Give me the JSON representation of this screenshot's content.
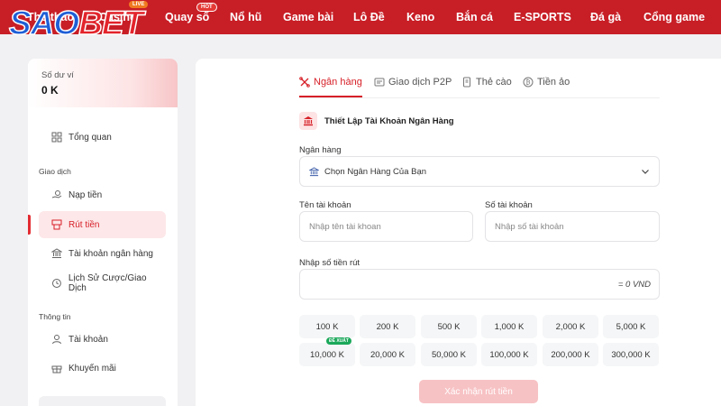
{
  "brand": {
    "logo_part1": "SAO",
    "logo_part2": "BET"
  },
  "nav": {
    "items": [
      "Thể thao",
      "Casino",
      "Quay số",
      "Nổ hũ",
      "Game bài",
      "Lô Đề",
      "Keno",
      "Bắn cá",
      "E-SPORTS",
      "Đá gà",
      "Cổng game"
    ],
    "badge_live": "LIVE",
    "badge_hot": "HOT"
  },
  "sidebar": {
    "wallet_label": "Số dư ví",
    "wallet_value": "0 K",
    "overview": "Tổng quan",
    "section_transactions": "Giao dịch",
    "deposit": "Nạp tiền",
    "withdraw": "Rút tiền",
    "bank_accounts": "Tài khoản ngân hàng",
    "history": "Lịch Sử Cược/Giao Dịch",
    "section_info": "Thông tin",
    "account": "Tài khoản",
    "promotions": "Khuyến mãi"
  },
  "tabs": [
    "Ngân hàng",
    "Giao dịch P2P",
    "Thẻ cào",
    "Tiền ảo"
  ],
  "form": {
    "section_title": "Thiết Lập Tài Khoản Ngân Hàng",
    "bank_label": "Ngân hàng",
    "bank_placeholder": "Chọn Ngân Hàng Của Bạn",
    "account_name_label": "Tên tài khoản",
    "account_name_placeholder": "Nhập tên tài khoan",
    "account_number_label": "Số tài khoản",
    "account_number_placeholder": "Nhập số tài khoản",
    "amount_label": "Nhập số tiền rút",
    "amount_unit": "= 0 VND",
    "amounts": [
      "100 K",
      "200 K",
      "500 K",
      "1,000 K",
      "2,000 K",
      "5,000 K",
      "10,000 K",
      "20,000 K",
      "50,000 K",
      "100,000 K",
      "200,000 K",
      "300,000 K"
    ],
    "suggest_tag": "ĐỀ XUẤT",
    "submit": "Xác nhận rút tiền"
  },
  "colors": {
    "brand_red": "#c81e26",
    "accent": "#d61f27",
    "logo_blue": "#1f5fd6",
    "suggest_green": "#1aa85a"
  }
}
